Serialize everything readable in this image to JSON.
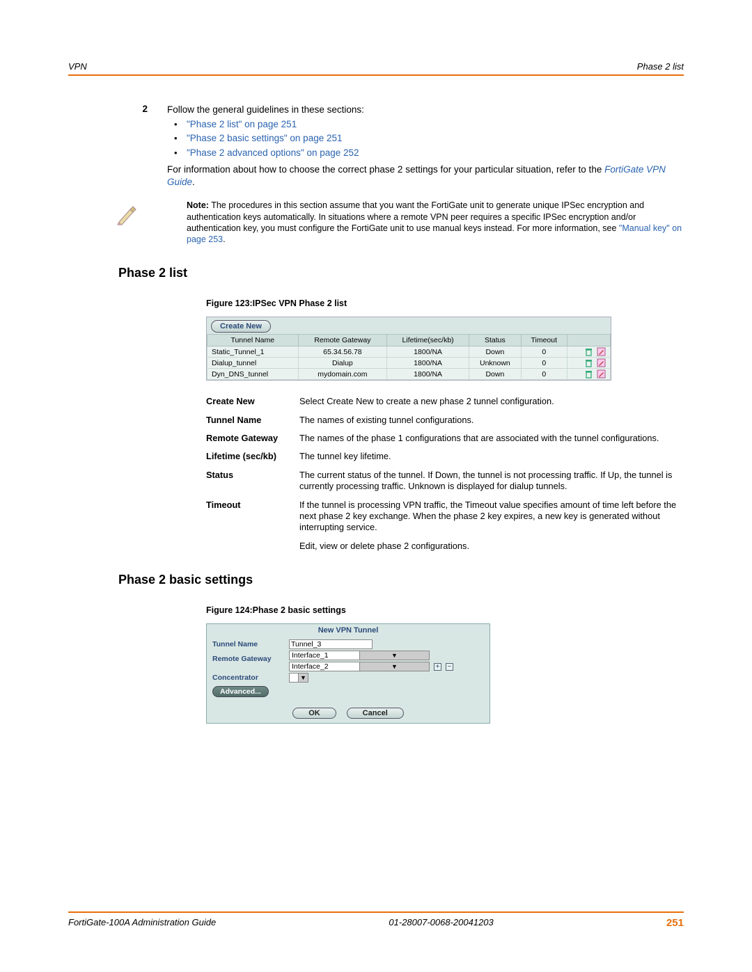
{
  "header": {
    "left": "VPN",
    "right": "Phase 2 list"
  },
  "step": {
    "num": "2",
    "intro": "Follow the general guidelines in these sections:",
    "links": [
      "\"Phase 2 list\" on page 251",
      "\"Phase 2 basic settings\" on page 251",
      "\"Phase 2 advanced options\" on page 252"
    ],
    "aftertext1": "For information about how to choose the correct phase 2 settings for your particular situation, refer to the ",
    "guide_link": "FortiGate VPN Guide",
    "period": "."
  },
  "note": {
    "label": "Note:",
    "body1": " The procedures in this section assume that you want the FortiGate unit to generate unique IPSec encryption and authentication keys automatically. In situations where a remote VPN peer requires a specific IPSec encryption and/or authentication key, you must configure the FortiGate unit to use manual keys instead. For more information, see ",
    "link": "\"Manual key\" on page 253",
    "tail": "."
  },
  "h2a": "Phase 2 list",
  "fig1_caption": "Figure 123:IPSec VPN Phase 2 list",
  "fig1": {
    "create_btn": "Create New",
    "headers": [
      "Tunnel Name",
      "Remote Gateway",
      "Lifetime(sec/kb)",
      "Status",
      "Timeout",
      ""
    ],
    "rows": [
      {
        "name": "Static_Tunnel_1",
        "gw": "65.34.56.78",
        "life": "1800/NA",
        "status": "Down",
        "timeout": "0"
      },
      {
        "name": "Dialup_tunnel",
        "gw": "Dialup",
        "life": "1800/NA",
        "status": "Unknown",
        "timeout": "0"
      },
      {
        "name": "Dyn_DNS_tunnel",
        "gw": "mydomain.com",
        "life": "1800/NA",
        "status": "Down",
        "timeout": "0"
      }
    ]
  },
  "defs": [
    {
      "term": "Create New",
      "desc": "Select Create New to create a new phase 2 tunnel configuration."
    },
    {
      "term": "Tunnel Name",
      "desc": "The names of existing tunnel configurations."
    },
    {
      "term": "Remote Gateway",
      "desc": "The names of the phase 1 configurations that are associated with the tunnel configurations."
    },
    {
      "term": "Lifetime (sec/kb)",
      "desc": "The tunnel key lifetime."
    },
    {
      "term": "Status",
      "desc": "The current status of the tunnel. If Down, the tunnel is not processing traffic. If Up, the tunnel is currently processing traffic. Unknown is displayed for dialup tunnels."
    },
    {
      "term": "Timeout",
      "desc": "If the tunnel is processing VPN traffic, the Timeout value specifies amount of time left before the next phase 2 key exchange. When the phase 2 key expires, a new key is generated without interrupting service."
    },
    {
      "term": "",
      "desc": "Edit, view or delete phase 2 configurations."
    }
  ],
  "h2b": "Phase 2 basic settings",
  "fig2_caption": "Figure 124:Phase 2 basic settings",
  "fig2": {
    "title": "New VPN Tunnel",
    "labels": {
      "tunnel": "Tunnel Name",
      "gateway": "Remote Gateway",
      "conc": "Concentrator",
      "adv": "Advanced..."
    },
    "tunnel_value": "Tunnel_3",
    "gw_options": [
      "Interface_1",
      "Interface_2"
    ],
    "plus": "+",
    "minus": "−",
    "ok": "OK",
    "cancel": "Cancel"
  },
  "footer": {
    "left": "FortiGate-100A Administration Guide",
    "mid": "01-28007-0068-20041203",
    "page": "251"
  }
}
